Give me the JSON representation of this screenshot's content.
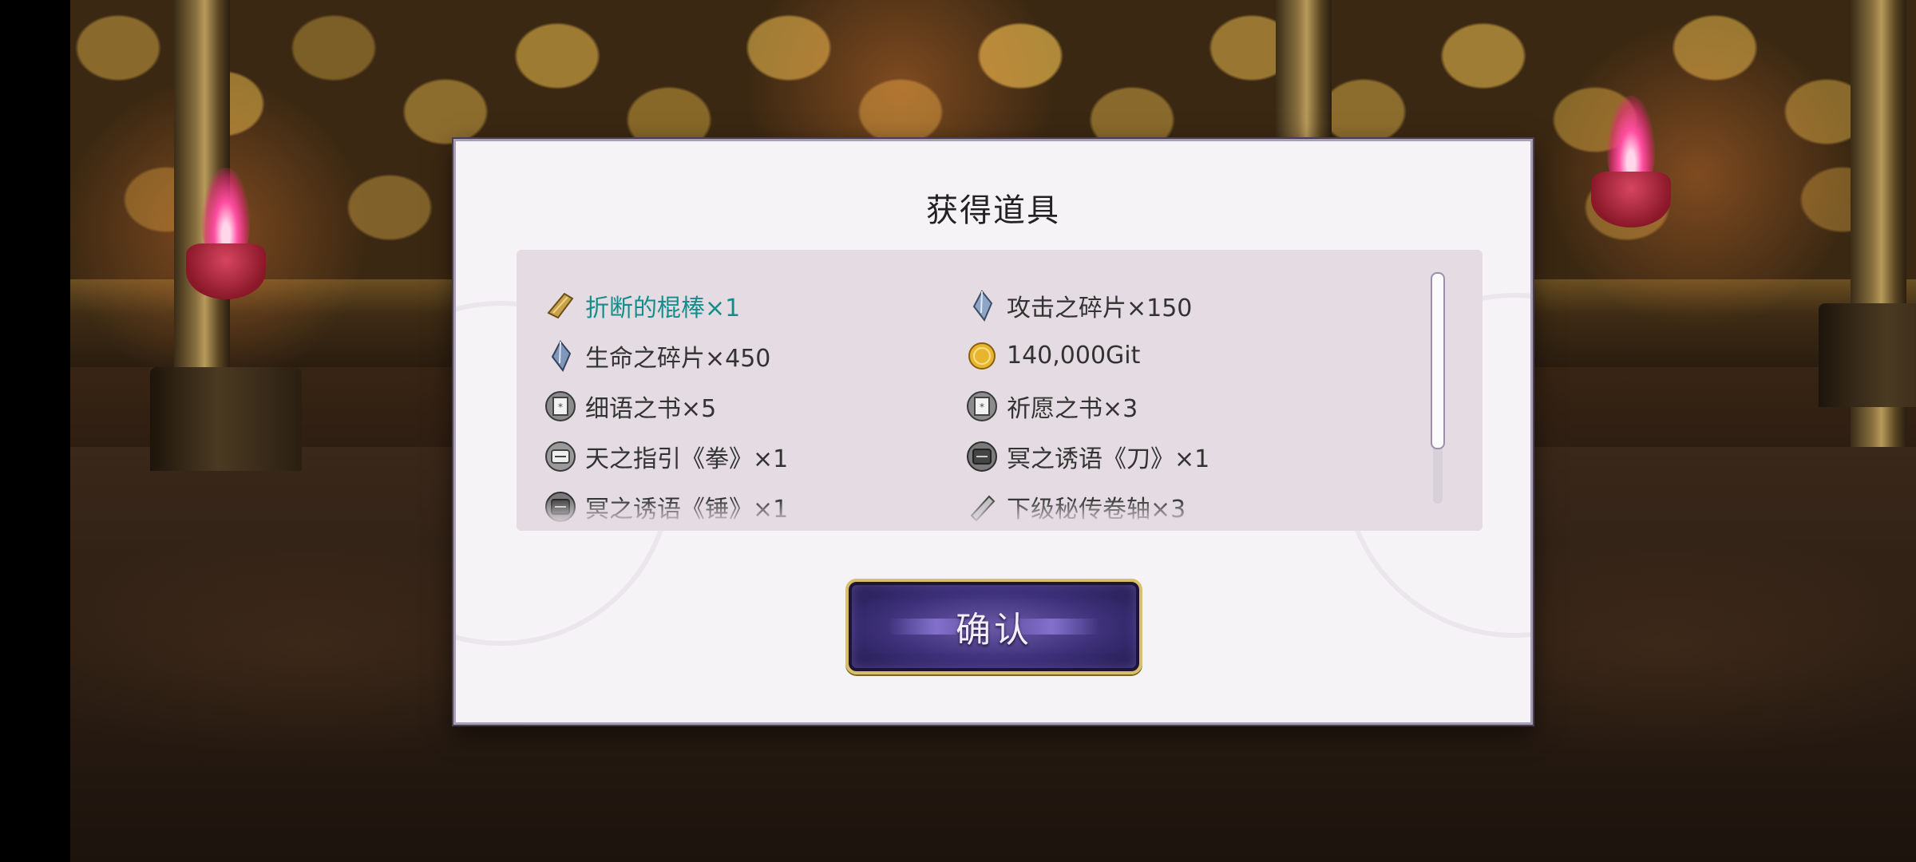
{
  "dialog": {
    "title": "获得道具",
    "confirm_label": "确认"
  },
  "items": [
    {
      "label": "折断的棍棒×1",
      "icon": "broken-club-icon",
      "highlight": true
    },
    {
      "label": "攻击之碎片×150",
      "icon": "attack-shard-icon"
    },
    {
      "label": "生命之碎片×450",
      "icon": "life-shard-icon"
    },
    {
      "label": "140,000Git",
      "icon": "gold-coin-icon"
    },
    {
      "label": "细语之书×5",
      "icon": "whisper-book-icon"
    },
    {
      "label": "祈愿之书×3",
      "icon": "prayer-book-icon"
    },
    {
      "label": "天之指引《拳》×1",
      "icon": "heaven-guide-icon"
    },
    {
      "label": "冥之诱语《刀》×1",
      "icon": "underworld-lure-icon"
    },
    {
      "label": "冥之诱语《锤》×1",
      "icon": "underworld-lure-icon"
    },
    {
      "label": "下级秘传卷轴×3",
      "icon": "scroll-icon"
    }
  ],
  "scroll": {
    "position": 0.0
  },
  "colors": {
    "highlight_text": "#168d8a",
    "button_border": "#d8bf6a",
    "button_fill": "#3c2f78",
    "flame": "#ff4da0"
  }
}
